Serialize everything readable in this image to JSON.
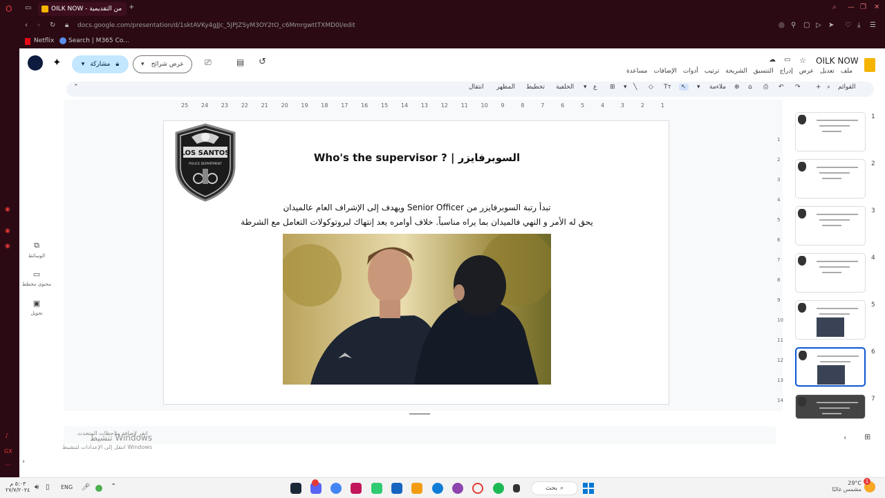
{
  "browser": {
    "tab_title": "OILK NOW - من التقديمية",
    "url": "docs.google.com/presentation/d/1sktAVKy4gJJc_5JPJZSyM3OY2tO_c6MmrgwttTXMD0I/edit",
    "bookmarks": [
      "Netflix",
      "Search | M365 Co..."
    ]
  },
  "docs": {
    "title": "OILK NOW",
    "menu": [
      "ملف",
      "تعديل",
      "عرض",
      "إدراج",
      "التنسيق",
      "الشريحة",
      "ترتيب",
      "أدوات",
      "الإضافات",
      "مساعدة"
    ],
    "share_label": "مشاركة",
    "slideshow_label": "عرض شرائح"
  },
  "toolbar": {
    "menus_label": "القوائم",
    "fit_label": "ملاءمة",
    "background_label": "الخلفية",
    "layout_label": "تخطيط",
    "theme_label": "المظهر",
    "transition_label": "انتقال"
  },
  "ruler": [
    "25",
    "24",
    "23",
    "22",
    "21",
    "20",
    "19",
    "18",
    "17",
    "16",
    "15",
    "14",
    "13",
    "12",
    "11",
    "10",
    "9",
    "8",
    "7",
    "6",
    "5",
    "4",
    "3",
    "2",
    "1"
  ],
  "vruler": [
    "1",
    "2",
    "3",
    "4",
    "5",
    "6",
    "7",
    "8",
    "9",
    "10",
    "11",
    "12",
    "13",
    "14"
  ],
  "slide": {
    "badge_text": "LOS SANTOS",
    "badge_sub": "POLICE DEPARTMENT",
    "title": "السوبرفايزر | ? Who's the supervisor",
    "body1": "تبدأ رتبة السوبرفايزر من Senior Officer ويهدف إلى الإشراف العام عالميدان",
    "body2": "يحق له الأمر و النهي فالميدان بما يراه مناسباً. خلاف أوامره يعد إنتهاك لبروتوكولات التعامل مع الشرطة"
  },
  "filmstrip": {
    "numbers": [
      "1",
      "2",
      "3",
      "4",
      "5",
      "6",
      "7"
    ],
    "selected": 6
  },
  "left_panel": [
    "الوسائط",
    "محتوى مخطط",
    "تحويل"
  ],
  "notes_placeholder": "انقر لإضافة ملاحظات المتحدث",
  "windows_watermark": {
    "line1": "تنشيط Windows",
    "line2": "انتقل إلى الإعدادات لتنشيط Windows"
  },
  "taskbar": {
    "search_label": "بحث",
    "lang": "ENG",
    "time": "٥:٠٣ م",
    "date": "٢٧/٧/٢٠٢٤",
    "weather_temp": "29°C",
    "weather_desc": "مشمس غالبًا",
    "notif_count": "1"
  },
  "colors": {
    "chrome_bg": "#2b0a14",
    "share_bg": "#c2e7ff",
    "selected_border": "#0b57d0",
    "docs_yellow": "#f4b400"
  }
}
